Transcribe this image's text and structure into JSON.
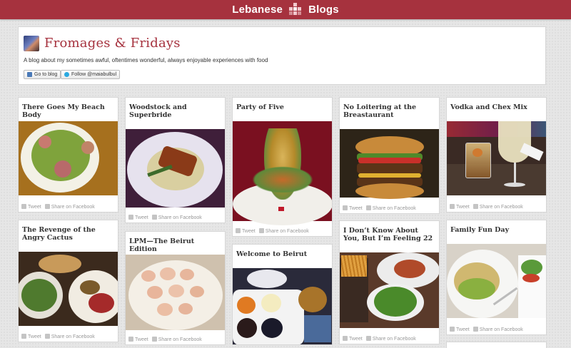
{
  "topbar": {
    "left_text": "Lebanese",
    "right_text": "Blogs",
    "accent": "#a6323e"
  },
  "blog": {
    "title": "Fromages & Fridays",
    "description": "A blog about my sometimes awful, oftentimes wonderful, always enjoyable experiences with food",
    "go_to_blog_label": "Go to blog",
    "follow_label": "Follow @maiabulbul"
  },
  "share": {
    "tweet": "Tweet",
    "facebook": "Share on Facebook"
  },
  "posts": [
    {
      "title": "There Goes My Beach Body"
    },
    {
      "title": "Woodstock and Superbride"
    },
    {
      "title": "Party of Five"
    },
    {
      "title": "No Loitering at the Breastaurant"
    },
    {
      "title": "Vodka and Chex Mix"
    },
    {
      "title": "The Revenge of the Angry Cactus"
    },
    {
      "title": "LPM—The Beirut Edition"
    },
    {
      "title": "Welcome to Beirut"
    },
    {
      "title": "I Don’t Know About You, But I’m Feeling 22"
    },
    {
      "title": "Family Fun Day"
    }
  ]
}
